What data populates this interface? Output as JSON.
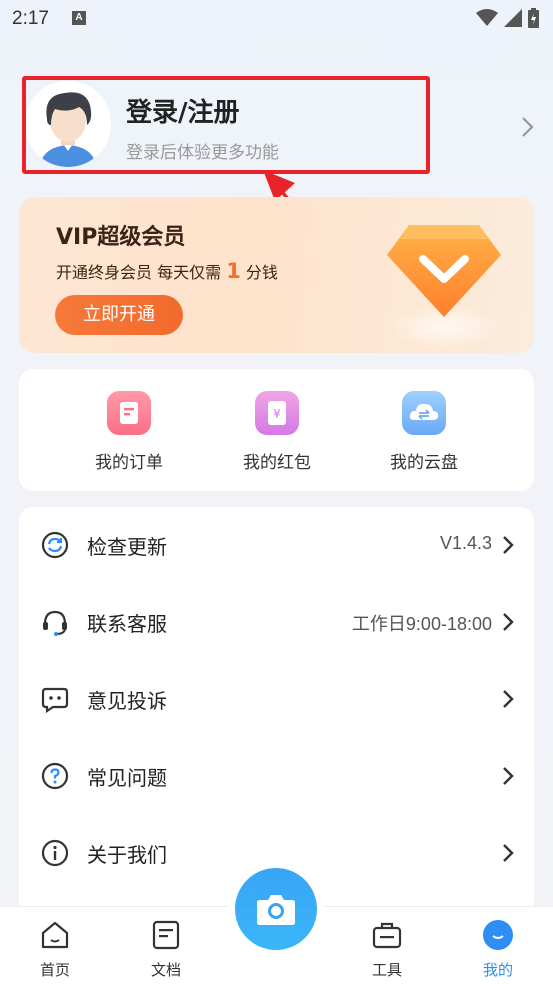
{
  "status_bar": {
    "time": "2:17",
    "notif_icon": "A"
  },
  "profile": {
    "title": "登录/注册",
    "subtitle": "登录后体验更多功能"
  },
  "vip": {
    "title": "VIP超级会员",
    "desc_prefix": "开通终身会员 每天仅需",
    "desc_num": "1",
    "desc_suffix": "分钱",
    "button": "立即开通"
  },
  "quick_actions": [
    {
      "label": "我的订单",
      "icon": "order-icon"
    },
    {
      "label": "我的红包",
      "icon": "redpacket-icon"
    },
    {
      "label": "我的云盘",
      "icon": "cloud-icon"
    }
  ],
  "menu": [
    {
      "label": "检查更新",
      "value": "V1.4.3",
      "icon": "refresh-icon"
    },
    {
      "label": "联系客服",
      "value": "工作日9:00-18:00",
      "icon": "headset-icon"
    },
    {
      "label": "意见投诉",
      "value": "",
      "icon": "feedback-icon"
    },
    {
      "label": "常见问题",
      "value": "",
      "icon": "question-icon"
    },
    {
      "label": "关于我们",
      "value": "",
      "icon": "info-icon"
    }
  ],
  "tabs": [
    {
      "label": "首页",
      "icon": "home-icon"
    },
    {
      "label": "文档",
      "icon": "document-icon"
    },
    {
      "label": "工具",
      "icon": "toolbox-icon"
    },
    {
      "label": "我的",
      "icon": "me-icon"
    }
  ],
  "colors": {
    "accent": "#2d8ef5",
    "highlight_border": "#e8242a",
    "vip_orange": "#f26a2d"
  }
}
